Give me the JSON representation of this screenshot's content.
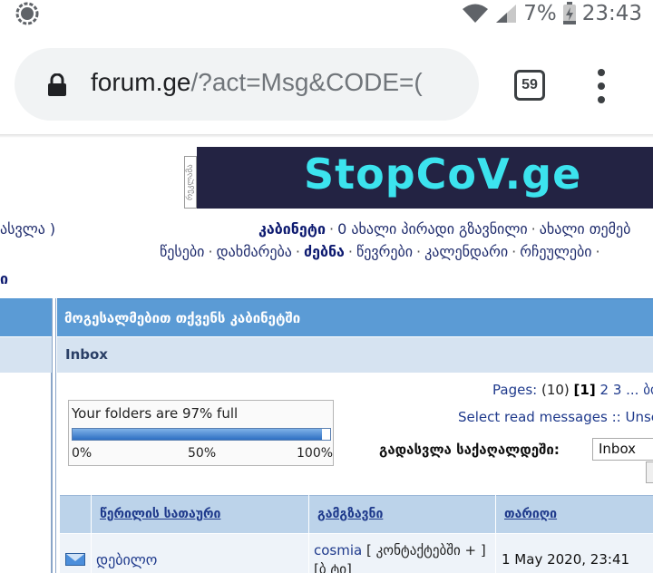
{
  "status_bar": {
    "battery": "7%",
    "time": "23:43",
    "icons": [
      "signal-app-icon",
      "wifi-icon",
      "cellular-signal-icon",
      "battery-charging-icon"
    ]
  },
  "browser": {
    "url_domain": "forum.ge",
    "url_path": "/?act=Msg&CODE=(",
    "tab_count": "59"
  },
  "banner": {
    "text": "StopCoV.ge",
    "ad_label": "რეკლამა"
  },
  "nav": {
    "left_fragment": "ასვლა )",
    "line1": [
      "კაბინეტი",
      "0 ახალი პირადი გზავნილი",
      "ახალი თემებ"
    ],
    "line2": [
      "წესები",
      "დახმარება",
      "ძებნა",
      "წევრები",
      "კალენდარი",
      "რჩეულები"
    ],
    "left_fragment2": "ი"
  },
  "cabinet": {
    "header": "მოგესალმებით თქვენს კაბინეტში",
    "folder": "Inbox"
  },
  "pagination": {
    "label": "Pages:",
    "total": "(10)",
    "current": "[1]",
    "pages": [
      "2",
      "3"
    ],
    "more": "... ბოლ"
  },
  "select_read": "Select read messages :: Unsele",
  "folder_usage": {
    "label": "Your folders are 97% full",
    "percent": 97,
    "scale": [
      "0%",
      "50%",
      "100%"
    ]
  },
  "goto": {
    "label": "გადასვლა საქაღალდეში:",
    "selected": "Inbox"
  },
  "table": {
    "headers": [
      "წერილის სათაური",
      "გამგზავნი",
      "თარიღი"
    ],
    "rows": [
      {
        "title": "დებილო",
        "sender": "cosmia",
        "sender_extra": "[ კონტაქტებში + ]",
        "sender_extra2": "[ბ ტი]",
        "date": "1 May 2020, 23:41"
      }
    ]
  }
}
